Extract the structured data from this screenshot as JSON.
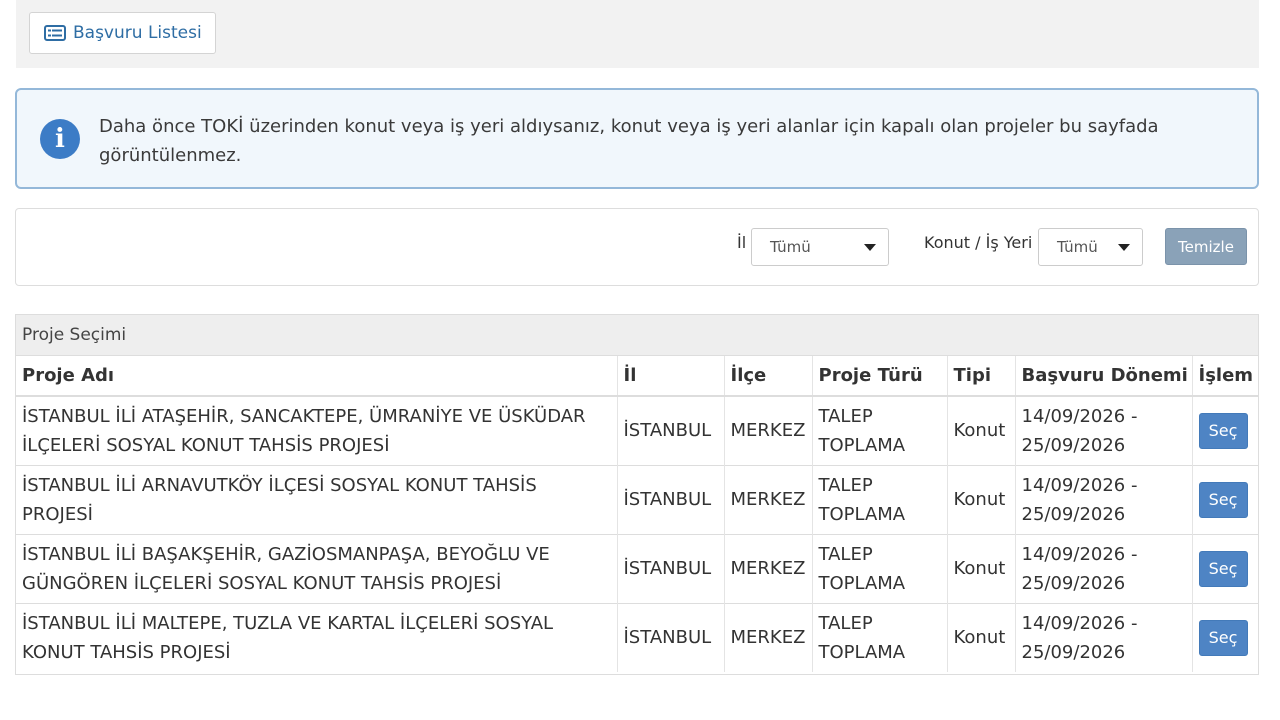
{
  "toolbar": {
    "list_button_label": "Başvuru Listesi",
    "list_icon": "list-icon"
  },
  "info": {
    "icon": "info-icon",
    "message": "Daha önce TOKİ üzerinden konut veya iş yeri aldıysanız, konut veya iş yeri alanlar için kapalı olan projeler bu sayfada görüntülenmez."
  },
  "filters": {
    "il_label": "İl",
    "il_value": "Tümü",
    "type_label": "Konut / İş Yeri",
    "type_value": "Tümü",
    "clear_label": "Temizle"
  },
  "projects": {
    "panel_title": "Proje Seçimi",
    "columns": [
      "Proje Adı",
      "İl",
      "İlçe",
      "Proje Türü",
      "Tipi",
      "Başvuru Dönemi",
      "İşlem"
    ],
    "rows": [
      {
        "name": "İSTANBUL İLİ ATAŞEHİR, SANCAKTEPE, ÜMRANİYE VE ÜSKÜDAR İLÇELERİ SOSYAL KONUT TAHSİS PROJESİ",
        "il": "İSTANBUL",
        "ilce": "MERKEZ",
        "tur": "TALEP TOPLAMA",
        "tip": "Konut",
        "donem": "14/09/2026 - 25/09/2026",
        "action": "Seç"
      },
      {
        "name": "İSTANBUL İLİ ARNAVUTKÖY İLÇESİ SOSYAL KONUT TAHSİS PROJESİ",
        "il": "İSTANBUL",
        "ilce": "MERKEZ",
        "tur": "TALEP TOPLAMA",
        "tip": "Konut",
        "donem": "14/09/2026 - 25/09/2026",
        "action": "Seç"
      },
      {
        "name": "İSTANBUL İLİ BAŞAKŞEHİR, GAZİOSMANPAŞA, BEYOĞLU VE GÜNGÖREN İLÇELERİ SOSYAL KONUT TAHSİS PROJESİ",
        "il": "İSTANBUL",
        "ilce": "MERKEZ",
        "tur": "TALEP TOPLAMA",
        "tip": "Konut",
        "donem": "14/09/2026 - 25/09/2026",
        "action": "Seç"
      },
      {
        "name": "İSTANBUL İLİ MALTEPE, TUZLA VE KARTAL İLÇELERİ SOSYAL KONUT TAHSİS PROJESİ",
        "il": "İSTANBUL",
        "ilce": "MERKEZ",
        "tur": "TALEP TOPLAMA",
        "tip": "Konut",
        "donem": "14/09/2026 - 25/09/2026",
        "action": "Seç"
      }
    ]
  }
}
